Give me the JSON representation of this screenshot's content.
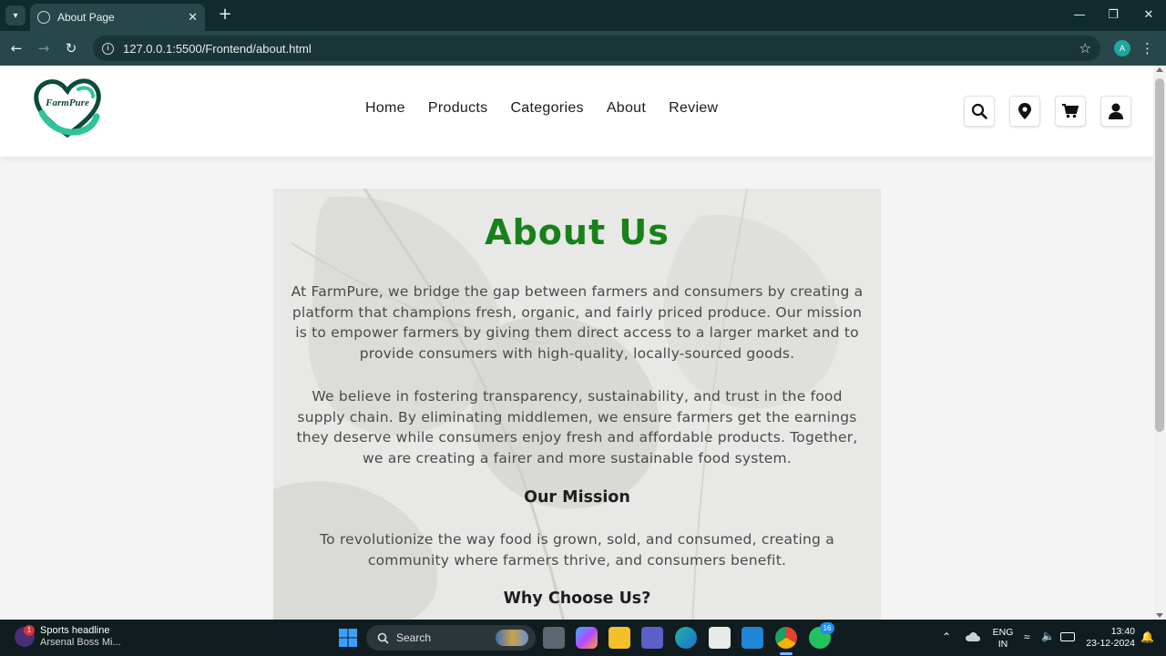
{
  "browser": {
    "tab_title": "About Page",
    "url": "127.0.0.1:5500/Frontend/about.html",
    "profile_initial": "A"
  },
  "site": {
    "logo_text": "FarmPure",
    "nav": [
      "Home",
      "Products",
      "Categories",
      "About",
      "Review"
    ],
    "header_icons": [
      "search-icon",
      "location-pin-icon",
      "cart-icon",
      "user-icon"
    ]
  },
  "about": {
    "title": "About Us",
    "paragraph1": "At FarmPure, we bridge the gap between farmers and consumers by creating a platform that champions fresh, organic, and fairly priced produce. Our mission is to empower farmers by giving them direct access to a larger market and to provide consumers with high-quality, locally-sourced goods.",
    "paragraph2": "We believe in fostering transparency, sustainability, and trust in the food supply chain. By eliminating middlemen, we ensure farmers get the earnings they deserve while consumers enjoy fresh and affordable products. Together, we are creating a fairer and more sustainable food system.",
    "mission_heading": "Our Mission",
    "mission_text": "To revolutionize the way food is grown, sold, and consumed, creating a community where farmers thrive, and consumers benefit.",
    "why_heading": "Why Choose Us?"
  },
  "colors": {
    "title_green": "#17821a",
    "browser_dark": "#0f2b2e",
    "toolbar": "#27474a"
  },
  "taskbar": {
    "news_badge": "1",
    "news_title": "Sports headline",
    "news_sub": "Arsenal Boss Mi...",
    "search_label": "Search",
    "teams_badge": "16",
    "lang_line1": "ENG",
    "lang_line2": "IN",
    "time": "13:40",
    "date": "23-12-2024"
  }
}
